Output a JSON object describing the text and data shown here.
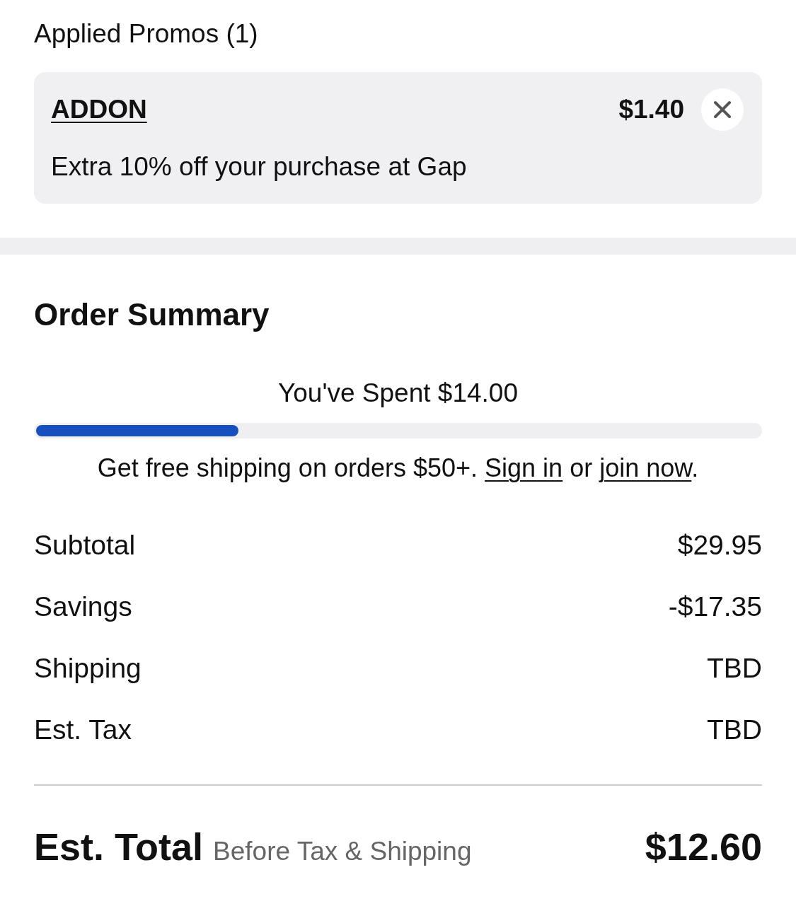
{
  "promos": {
    "title": "Applied Promos (1)",
    "items": [
      {
        "code": "ADDON",
        "amount": "$1.40",
        "description": "Extra 10% off your purchase at Gap"
      }
    ]
  },
  "order_summary": {
    "title": "Order Summary",
    "progress": {
      "label": "You've Spent $14.00",
      "level": 0.28
    },
    "message": [
      {
        "kind": "text",
        "text": "Get free shipping on orders $50+."
      },
      {
        "kind": "link",
        "text": "Sign in"
      },
      {
        "kind": "text",
        "text": "or"
      },
      {
        "kind": "link",
        "text": "join now"
      },
      {
        "kind": "end",
        "text": "."
      }
    ],
    "rows": [
      {
        "label": "Subtotal",
        "value": "$29.95"
      },
      {
        "label": "Savings",
        "value": "-$17.35"
      },
      {
        "label": "Shipping",
        "value": "TBD"
      },
      {
        "label": "Est. Tax",
        "value": "TBD"
      }
    ],
    "total": {
      "label": "Est. Total",
      "note": "Before Tax & Shipping",
      "value": "$12.60"
    }
  }
}
